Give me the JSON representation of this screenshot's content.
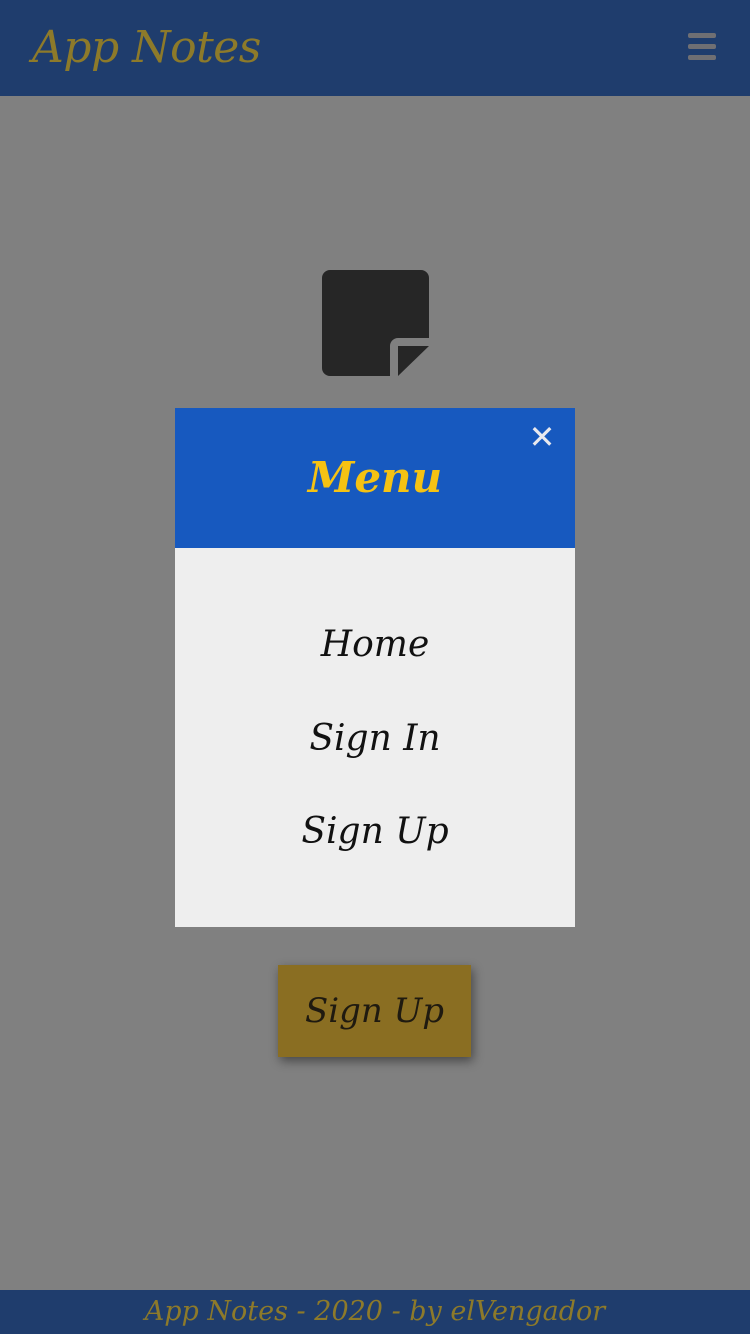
{
  "header": {
    "brand": "App Notes",
    "menu_icon": "hamburger-icon"
  },
  "main": {
    "icon": "sticky-note-icon",
    "signup_label": "Sign Up"
  },
  "modal": {
    "title": "Menu",
    "close_icon": "close-icon",
    "items": [
      {
        "label": "Home"
      },
      {
        "label": "Sign In"
      },
      {
        "label": "Sign Up"
      }
    ]
  },
  "footer": {
    "text": "App Notes - 2020 - by elVengador"
  },
  "colors": {
    "header_bg": "#1f3d6d",
    "brand_gold": "#8d7a2a",
    "modal_header_bg": "#1759bf",
    "modal_title": "#f5c213",
    "overlay_gray": "#808080",
    "signup_button": "#8a6e22"
  }
}
